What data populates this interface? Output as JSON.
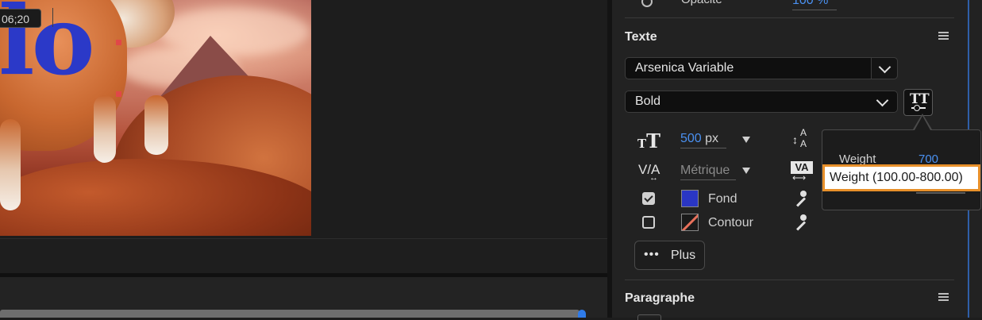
{
  "preview": {
    "title_text": "lo"
  },
  "timeline": {
    "timecode": "06;20"
  },
  "panel": {
    "opacity": {
      "label": "Opacité",
      "value": "100 %"
    },
    "text_section": {
      "title": "Texte",
      "font_family": "Arsenica Variable",
      "font_style": "Bold",
      "size": {
        "value": "500",
        "unit": "px"
      },
      "kerning": "Métrique",
      "fill": {
        "label": "Fond",
        "checked": true,
        "color": "#2a36c4"
      },
      "stroke": {
        "label": "Contour",
        "checked": false,
        "color": "#e7705a"
      },
      "more_button": "Plus"
    },
    "paragraph_section": {
      "title": "Paragraphe"
    },
    "accent_color": "#4a90f0"
  },
  "weight_popup": {
    "label": "Weight",
    "value": "700",
    "tooltip": "Weight (100.00-800.00)",
    "tooltip_border_color": "#e8902a"
  }
}
